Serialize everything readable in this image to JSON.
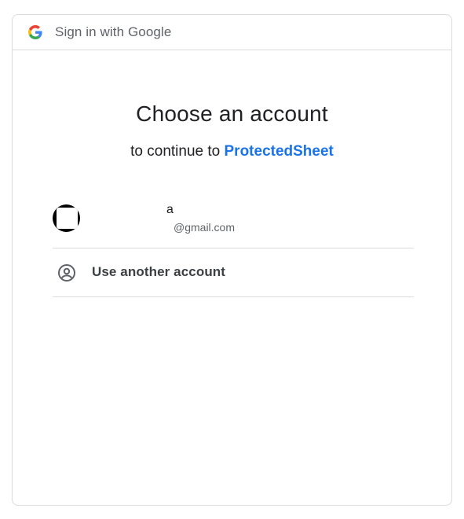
{
  "header": {
    "title": "Sign in with Google",
    "logo_icon": "google-g-icon"
  },
  "main": {
    "heading": "Choose an account",
    "subheading_prefix": "to continue to ",
    "app_name": "ProtectedSheet"
  },
  "accounts": [
    {
      "name": "a",
      "email": "@gmail.com",
      "avatar_icon": "avatar"
    }
  ],
  "use_another": {
    "label": "Use another account",
    "icon": "account-circle-icon"
  },
  "colors": {
    "link": "#1a73e8",
    "border": "#dadce0",
    "text": "#202124",
    "secondary": "#5f6368"
  }
}
